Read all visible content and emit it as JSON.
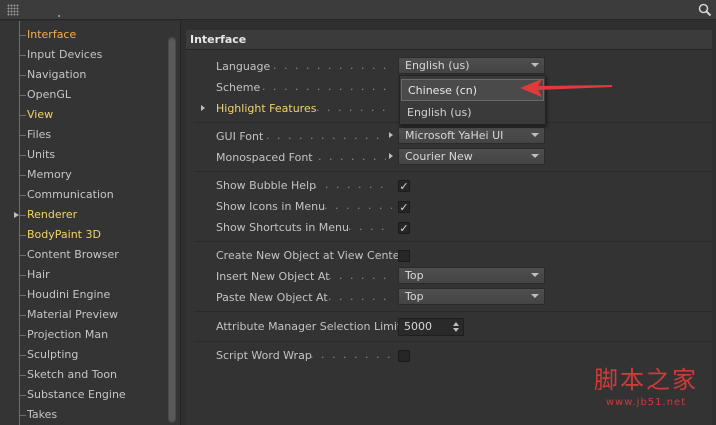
{
  "topbar": {
    "icons": [
      "grip-icon",
      "search-icon"
    ]
  },
  "sidebar": {
    "items": [
      {
        "label": "Interface",
        "state": "selected"
      },
      {
        "label": "Input Devices"
      },
      {
        "label": "Navigation"
      },
      {
        "label": "OpenGL"
      },
      {
        "label": "View",
        "state": "highlighted"
      },
      {
        "label": "Files"
      },
      {
        "label": "Units"
      },
      {
        "label": "Memory"
      },
      {
        "label": "Communication"
      },
      {
        "label": "Renderer",
        "state": "highlighted",
        "expandable": true
      },
      {
        "label": "BodyPaint 3D",
        "state": "highlighted"
      },
      {
        "label": "Content Browser"
      },
      {
        "label": "Hair"
      },
      {
        "label": "Houdini Engine"
      },
      {
        "label": "Material Preview"
      },
      {
        "label": "Projection Man"
      },
      {
        "label": "Sculpting"
      },
      {
        "label": "Sketch and Toon"
      },
      {
        "label": "Substance Engine"
      },
      {
        "label": "Takes"
      }
    ]
  },
  "main": {
    "title": "Interface",
    "language": {
      "label": "Language",
      "value": "English (us)"
    },
    "scheme": {
      "label": "Scheme"
    },
    "highlight_features": {
      "label": "Highlight Features"
    },
    "language_menu": {
      "options": [
        "Chinese (cn)",
        "English (us)"
      ],
      "hovered": "Chinese (cn)"
    },
    "gui_font": {
      "label": "GUI Font",
      "value": "Microsoft YaHei UI"
    },
    "mono_font": {
      "label": "Monospaced Font",
      "value": "Courier New"
    },
    "bubble_help": {
      "label": "Show Bubble Help",
      "checked": true
    },
    "icons_in_menu": {
      "label": "Show Icons in Menu",
      "checked": true
    },
    "shortcuts_in_menu": {
      "label": "Show Shortcuts in Menu",
      "checked": true
    },
    "create_at_center": {
      "label": "Create New Object at View Center",
      "checked": false
    },
    "insert_at": {
      "label": "Insert New Object At",
      "value": "Top"
    },
    "paste_at": {
      "label": "Paste New Object At",
      "value": "Top"
    },
    "selection_limit": {
      "label": "Attribute Manager Selection Limit",
      "value": "5000"
    },
    "word_wrap": {
      "label": "Script Word Wrap",
      "checked": false
    }
  },
  "colors": {
    "accent_selected": "#f5b04a",
    "highlight_text": "#f0d36a",
    "annotation_arrow": "#e03b3b"
  },
  "watermark": {
    "title": "脚本之家",
    "url": "www.jb51.net"
  }
}
